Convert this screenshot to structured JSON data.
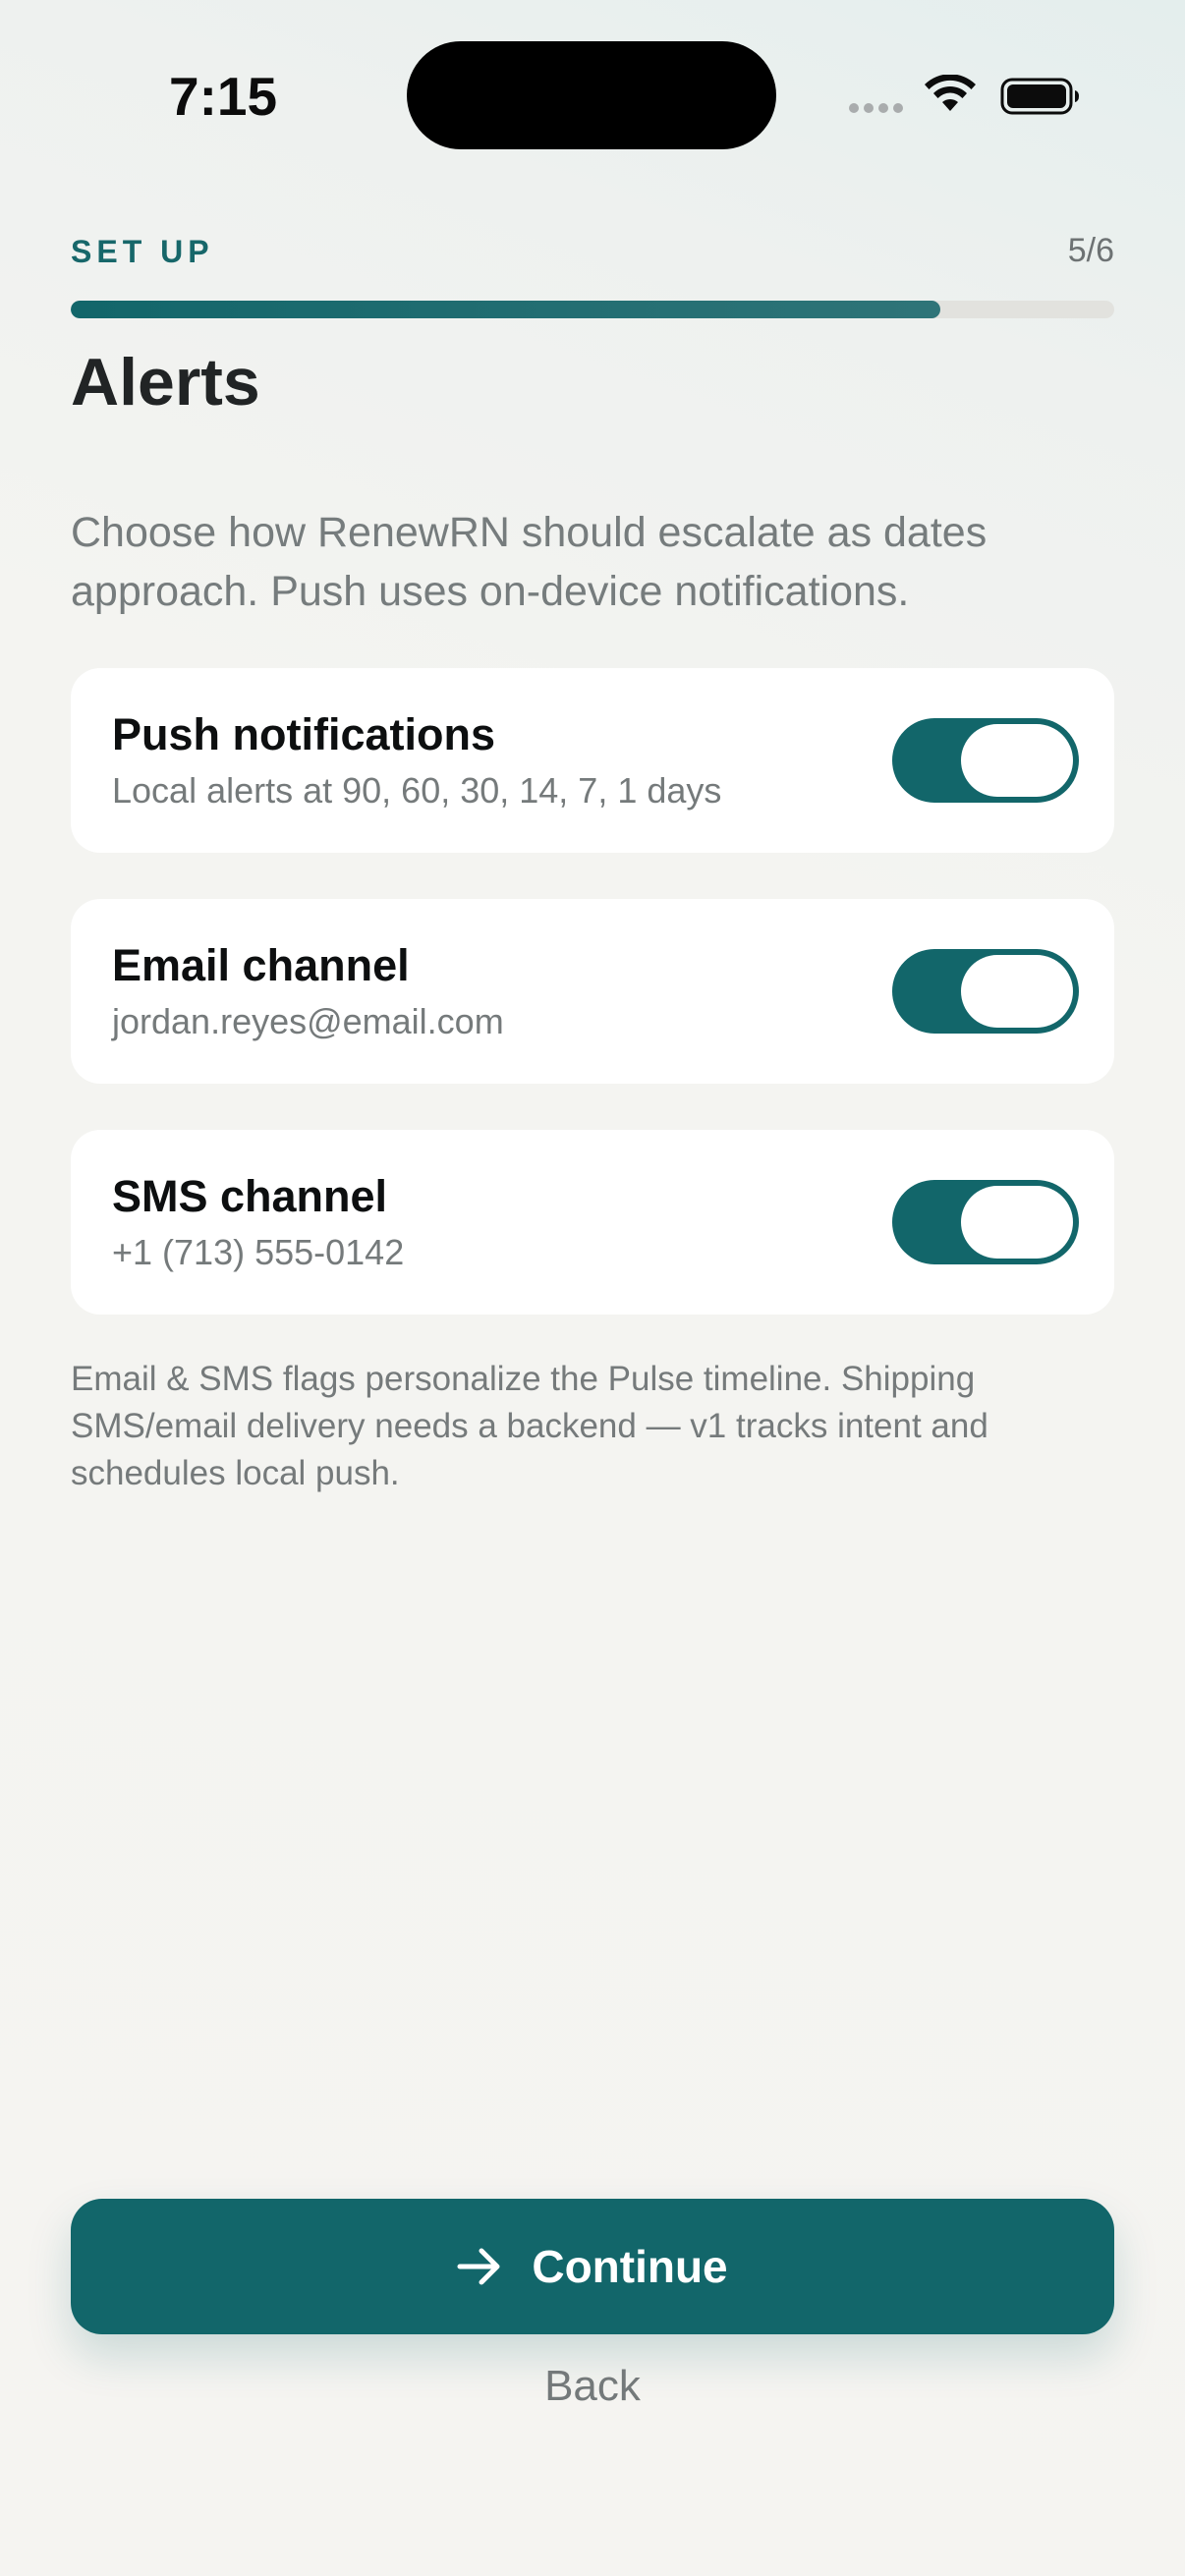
{
  "status_bar": {
    "time": "7:15",
    "icons": [
      "signal-dots-icon",
      "wifi-icon",
      "battery-icon"
    ]
  },
  "header": {
    "step_label": "SET UP",
    "step_count": "5/6",
    "progress": 0.833,
    "title": "Alerts"
  },
  "intro": "Choose how RenewRN should escalate as dates approach. Push uses on-device notifications.",
  "channels": [
    {
      "title": "Push notifications",
      "subtitle": "Local alerts at 90, 60, 30, 14, 7, 1 days",
      "enabled": true
    },
    {
      "title": "Email channel",
      "subtitle": "jordan.reyes@email.com",
      "enabled": true
    },
    {
      "title": "SMS channel",
      "subtitle": "+1 (713) 555-0142",
      "enabled": true
    }
  ],
  "footnote": "Email & SMS flags personalize the Pulse timeline. Shipping SMS/email delivery needs a backend — v1 tracks intent and schedules local push.",
  "actions": {
    "continue_label": "Continue",
    "continue_icon": "arrow-right-icon",
    "back_label": "Back"
  },
  "colors": {
    "accent": "#12666A",
    "background": "#F5F4F1",
    "card": "#FFFFFF",
    "muted_text": "#757A7B"
  }
}
